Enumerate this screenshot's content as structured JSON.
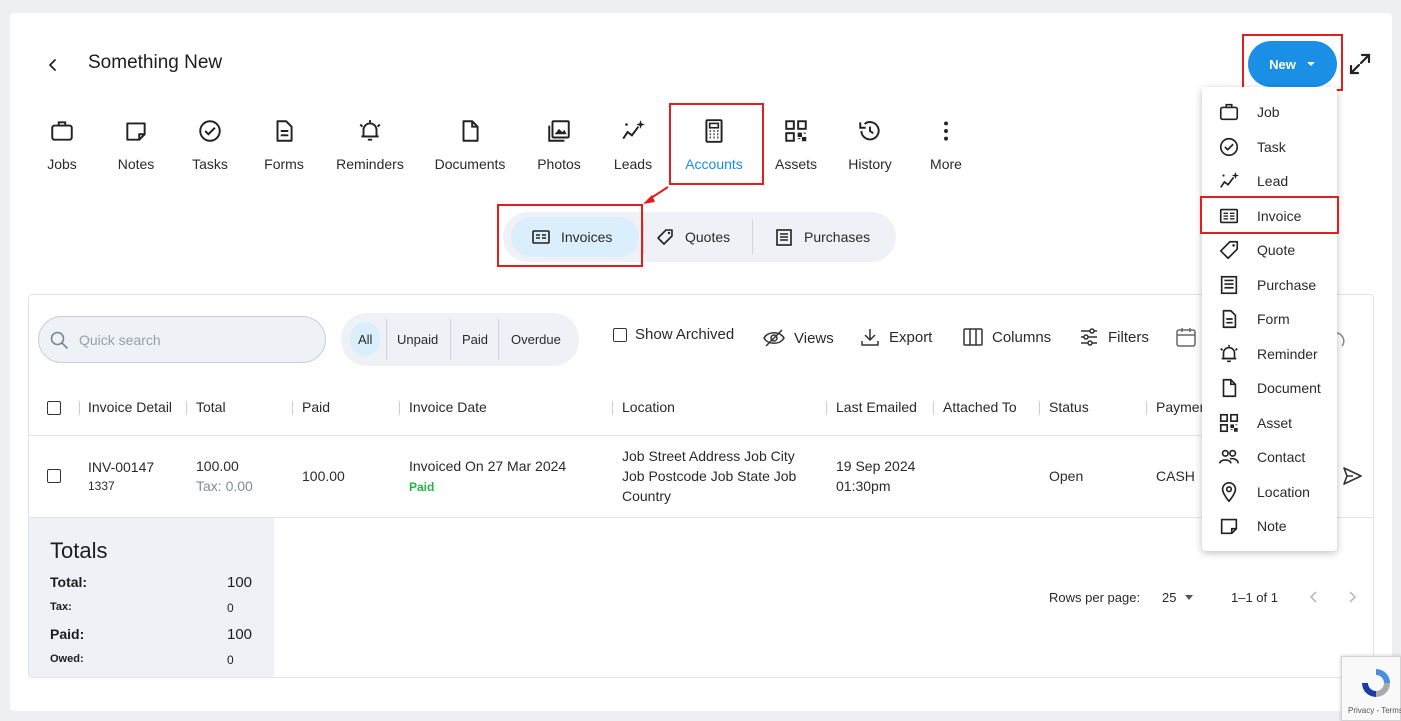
{
  "header": {
    "title": "Something New",
    "new_label": "New"
  },
  "nav": [
    {
      "label": "Jobs",
      "icon": "briefcase-icon"
    },
    {
      "label": "Notes",
      "icon": "note-icon"
    },
    {
      "label": "Tasks",
      "icon": "check-circle-icon"
    },
    {
      "label": "Forms",
      "icon": "form-icon"
    },
    {
      "label": "Reminders",
      "icon": "bell-icon"
    },
    {
      "label": "Documents",
      "icon": "document-icon"
    },
    {
      "label": "Photos",
      "icon": "photos-icon"
    },
    {
      "label": "Leads",
      "icon": "sparkle-icon"
    },
    {
      "label": "Accounts",
      "icon": "calculator-icon"
    },
    {
      "label": "Assets",
      "icon": "qr-icon"
    },
    {
      "label": "History",
      "icon": "history-icon"
    },
    {
      "label": "More",
      "icon": "more-vertical-icon"
    }
  ],
  "subtabs": [
    {
      "label": "Invoices"
    },
    {
      "label": "Quotes"
    },
    {
      "label": "Purchases"
    }
  ],
  "toolbar": {
    "search_placeholder": "Quick search",
    "filters": [
      "All",
      "Unpaid",
      "Paid",
      "Overdue"
    ],
    "show_archived": "Show Archived",
    "views": "Views",
    "export": "Export",
    "columns": "Columns",
    "filters_label": "Filters"
  },
  "table": {
    "headers": [
      "Invoice Detail",
      "Total",
      "Paid",
      "Invoice Date",
      "Location",
      "Last Emailed",
      "Attached To",
      "Status",
      "Paymen"
    ],
    "row": {
      "invoice_no": "INV-00147",
      "invoice_sub": "1337",
      "total": "100.00",
      "tax": "Tax: 0.00",
      "paid": "100.00",
      "invoice_date": "Invoiced On 27 Mar 2024",
      "paid_badge": "Paid",
      "location_1": "Job Street Address Job City",
      "location_2": "Job Postcode Job State Job",
      "location_3": "Country",
      "emailed_1": "19 Sep 2024",
      "emailed_2": "01:30pm",
      "status": "Open",
      "payment": "CASH"
    }
  },
  "totals": {
    "title": "Totals",
    "total_label": "Total:",
    "total_value": "100",
    "tax_label": "Tax:",
    "tax_value": "0",
    "paid_label": "Paid:",
    "paid_value": "100",
    "owed_label": "Owed:",
    "owed_value": "0"
  },
  "pagination": {
    "rows_label": "Rows per page:",
    "rows_value": "25",
    "range": "1–1 of 1"
  },
  "dropdown": [
    {
      "label": "Job",
      "icon": "briefcase-icon"
    },
    {
      "label": "Task",
      "icon": "check-circle-icon"
    },
    {
      "label": "Lead",
      "icon": "sparkle-icon"
    },
    {
      "label": "Invoice",
      "icon": "invoice-icon"
    },
    {
      "label": "Quote",
      "icon": "tag-icon"
    },
    {
      "label": "Purchase",
      "icon": "receipt-icon"
    },
    {
      "label": "Form",
      "icon": "form-icon"
    },
    {
      "label": "Reminder",
      "icon": "bell-icon"
    },
    {
      "label": "Document",
      "icon": "document-icon"
    },
    {
      "label": "Asset",
      "icon": "qr-icon"
    },
    {
      "label": "Contact",
      "icon": "contacts-icon"
    },
    {
      "label": "Location",
      "icon": "location-icon"
    },
    {
      "label": "Note",
      "icon": "note-icon"
    }
  ],
  "colors": {
    "accent": "#1b8fe6",
    "highlight": "#e11d1d",
    "paid": "#24b24a",
    "tax": "#7c8ca8"
  }
}
